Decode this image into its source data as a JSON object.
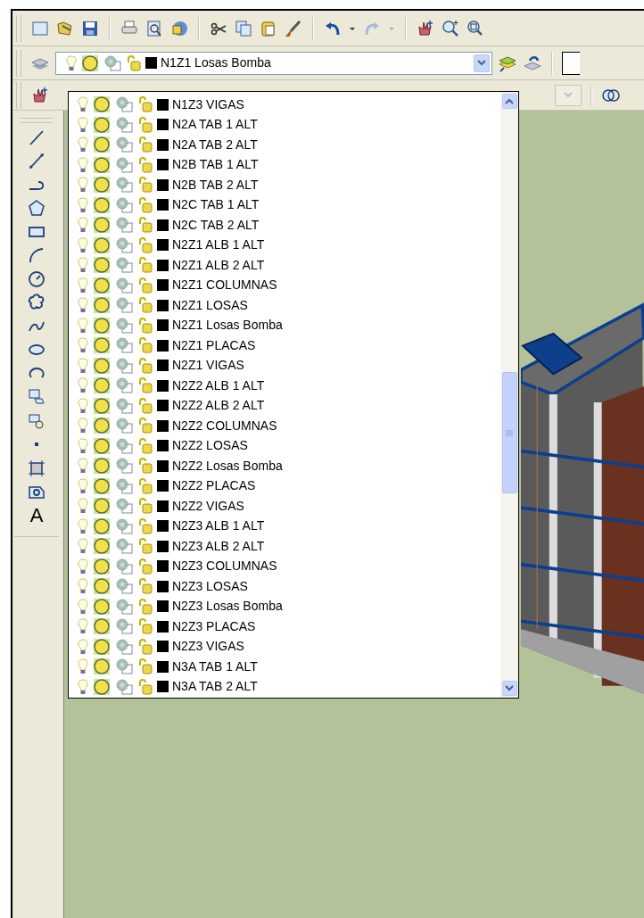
{
  "layer_toolbar": {
    "current_layer": {
      "name": "N1Z1 Losas Bomba",
      "color": "#000000"
    }
  },
  "layer_dropdown": {
    "expanded": true,
    "items": [
      {
        "name": "N1Z3 VIGAS",
        "color": "#000000"
      },
      {
        "name": "N2A TAB 1 ALT",
        "color": "#000000"
      },
      {
        "name": "N2A TAB 2 ALT",
        "color": "#000000"
      },
      {
        "name": "N2B TAB 1 ALT",
        "color": "#000000"
      },
      {
        "name": "N2B TAB 2 ALT",
        "color": "#000000"
      },
      {
        "name": "N2C TAB 1 ALT",
        "color": "#000000"
      },
      {
        "name": "N2C TAB 2 ALT",
        "color": "#000000"
      },
      {
        "name": "N2Z1 ALB 1 ALT",
        "color": "#000000"
      },
      {
        "name": "N2Z1 ALB 2 ALT",
        "color": "#000000"
      },
      {
        "name": "N2Z1 COLUMNAS",
        "color": "#000000"
      },
      {
        "name": "N2Z1 LOSAS",
        "color": "#000000"
      },
      {
        "name": "N2Z1 Losas Bomba",
        "color": "#000000"
      },
      {
        "name": "N2Z1 PLACAS",
        "color": "#000000"
      },
      {
        "name": "N2Z1 VIGAS",
        "color": "#000000"
      },
      {
        "name": "N2Z2 ALB 1 ALT",
        "color": "#000000"
      },
      {
        "name": "N2Z2 ALB 2 ALT",
        "color": "#000000"
      },
      {
        "name": "N2Z2 COLUMNAS",
        "color": "#000000"
      },
      {
        "name": "N2Z2 LOSAS",
        "color": "#000000"
      },
      {
        "name": "N2Z2 Losas Bomba",
        "color": "#000000"
      },
      {
        "name": "N2Z2 PLACAS",
        "color": "#000000"
      },
      {
        "name": "N2Z2 VIGAS",
        "color": "#000000"
      },
      {
        "name": "N2Z3 ALB 1 ALT",
        "color": "#000000"
      },
      {
        "name": "N2Z3 ALB 2 ALT",
        "color": "#000000"
      },
      {
        "name": "N2Z3 COLUMNAS",
        "color": "#000000"
      },
      {
        "name": "N2Z3 LOSAS",
        "color": "#000000"
      },
      {
        "name": "N2Z3 Losas Bomba",
        "color": "#000000"
      },
      {
        "name": "N2Z3 PLACAS",
        "color": "#000000"
      },
      {
        "name": "N2Z3 VIGAS",
        "color": "#000000"
      },
      {
        "name": "N3A TAB 1 ALT",
        "color": "#000000"
      },
      {
        "name": "N3A TAB 2 ALT",
        "color": "#000000"
      }
    ]
  },
  "draw_toolbar": {
    "text_tool_label": "A"
  }
}
